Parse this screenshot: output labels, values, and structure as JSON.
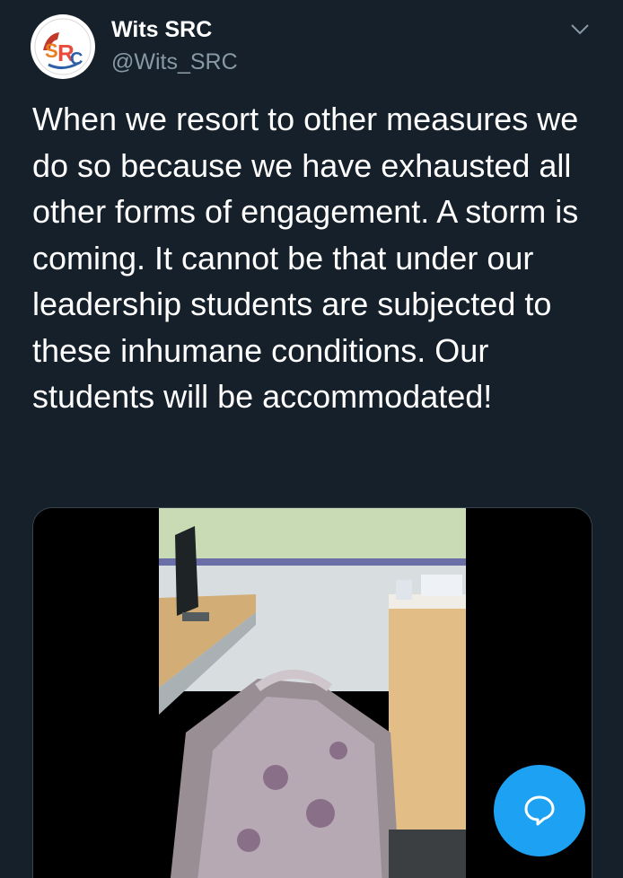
{
  "tweet": {
    "author": {
      "display_name": "Wits SRC",
      "handle": "@Wits_SRC",
      "avatar_icon": "src-logo-icon",
      "avatar_logo_text": "STUDENT REPRESENTATIVE COUNCIL"
    },
    "menu_icon": "chevron-down-icon",
    "text": "When we resort to other measures we do so because we have exhausted all other forms of engagement. A storm is coming. It cannot be that under our leadership students are subjected to these inhumane conditions. Our students will be accommodated!",
    "media": {
      "type": "video",
      "description_icon": "video-thumbnail"
    }
  },
  "fab": {
    "icon": "compose-message-icon"
  },
  "colors": {
    "background": "#15202b",
    "text": "#ffffff",
    "secondary_text": "#8899a6",
    "accent": "#1da1f2"
  }
}
